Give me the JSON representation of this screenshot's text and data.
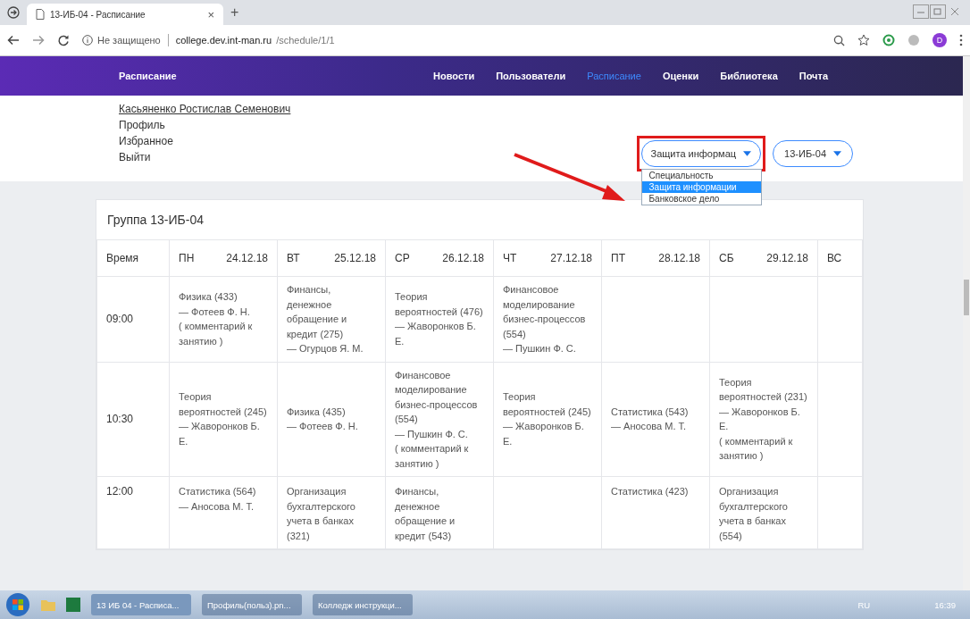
{
  "browser": {
    "tab_title": "13-ИБ-04 - Расписание",
    "close": "×",
    "new_tab": "+",
    "security": "Не защищено",
    "url_host": "college.dev.int-man.ru",
    "url_path": "/schedule/1/1",
    "profile": "D"
  },
  "nav": {
    "brand": "Расписание",
    "items": [
      {
        "label": "Новости",
        "selected": false
      },
      {
        "label": "Пользователи",
        "selected": false
      },
      {
        "label": "Расписание",
        "selected": true
      },
      {
        "label": "Оценки",
        "selected": false
      },
      {
        "label": "Библиотека",
        "selected": false
      },
      {
        "label": "Почта",
        "selected": false
      }
    ]
  },
  "user": {
    "name": "Касьяненко Ростислав Семенович",
    "links": [
      "Профиль",
      "Избранное",
      "Выйти"
    ]
  },
  "filters": {
    "specialty": {
      "value": "Защита информац",
      "highlighted": true,
      "expanded": true,
      "options": [
        {
          "label": "Специальность",
          "selected": false
        },
        {
          "label": "Защита информации",
          "selected": true
        },
        {
          "label": "Банковское дело",
          "selected": false
        }
      ]
    },
    "group": {
      "value": "13-ИБ-04"
    }
  },
  "schedule": {
    "title": "Группа 13-ИБ-04",
    "time_header": "Время",
    "columns": [
      {
        "day": "ПН",
        "date": "24.12.18"
      },
      {
        "day": "ВТ",
        "date": "25.12.18"
      },
      {
        "day": "СР",
        "date": "26.12.18"
      },
      {
        "day": "ЧТ",
        "date": "27.12.18"
      },
      {
        "day": "ПТ",
        "date": "28.12.18"
      },
      {
        "day": "СБ",
        "date": "29.12.18"
      },
      {
        "day": "ВС"
      }
    ],
    "rows": [
      {
        "time": "09:00",
        "cells": [
          "Физика (433)\n— Фотеев Ф. Н.\n( комментарий к занятию )",
          "Финансы, денежное обращение и кредит (275)\n— Огурцов Я. М.",
          "Теория вероятностей (476)\n— Жаворонков Б. Е.",
          "Финансовое моделирование бизнес-процессов (554)\n— Пушкин Ф. С.",
          "",
          "",
          ""
        ]
      },
      {
        "time": "10:30",
        "cells": [
          "Теория вероятностей (245)\n— Жаворонков Б. Е.",
          "Физика (435)\n— Фотеев Ф. Н.",
          "Финансовое моделирование бизнес-процессов (554)\n— Пушкин Ф. С.\n( комментарий к занятию )",
          "Теория вероятностей (245)\n— Жаворонков Б. Е.",
          "Статистика (543)\n— Аносова М. Т.",
          "Теория вероятностей (231)\n— Жаворонков Б. Е.\n( комментарий к занятию )",
          ""
        ]
      },
      {
        "time": "12:00",
        "cells": [
          "Статистика (564)\n— Аносова М. Т.",
          "Организация бухгалтерского учета в банках (321)",
          "Финансы, денежное обращение и кредит (543)",
          "",
          "Статистика (423)",
          "Организация бухгалтерского учета в банках (554)",
          ""
        ]
      }
    ]
  },
  "taskbar": {
    "tasks": [
      {
        "label": "13 ИБ 04 - Расписа...",
        "selected": true
      },
      {
        "label": "Профиль(польз).pn...",
        "selected": false
      },
      {
        "label": "Колледж инструкци...",
        "selected": false
      }
    ],
    "language": "RU",
    "clock": "16:39"
  }
}
